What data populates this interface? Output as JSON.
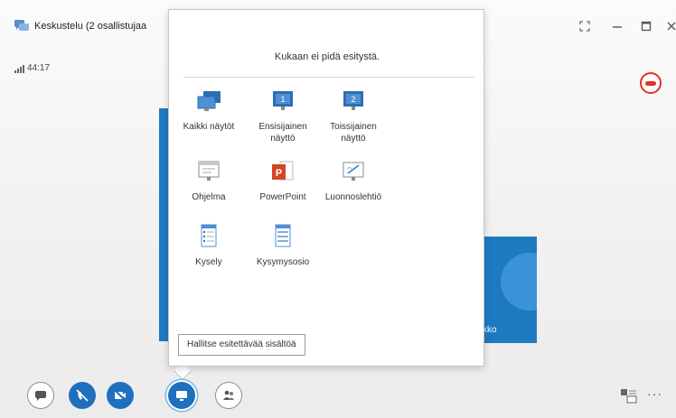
{
  "window": {
    "title": "Keskustelu (2 osallistujaa",
    "controls": [
      "restore",
      "minimize",
      "maximize",
      "close"
    ]
  },
  "call": {
    "timer": "44:17",
    "participant_label": "kko"
  },
  "present_panel": {
    "message": "Kukaan ei pidä esitystä.",
    "items": [
      {
        "label": "Kaikki näytöt",
        "icon": "all-monitors-icon"
      },
      {
        "label": "Ensisijainen näyttö",
        "icon": "primary-monitor-icon"
      },
      {
        "label": "Toissijainen näyttö",
        "icon": "secondary-monitor-icon"
      },
      {
        "label": "Ohjelma",
        "icon": "program-icon"
      },
      {
        "label": "PowerPoint",
        "icon": "powerpoint-icon"
      },
      {
        "label": "Luonnoslehtiö",
        "icon": "whiteboard-icon"
      },
      {
        "label": "Kysely",
        "icon": "poll-icon"
      },
      {
        "label": "Kysymysosio",
        "icon": "qa-icon"
      }
    ],
    "monitor_numbers": [
      "1",
      "2"
    ]
  },
  "tooltip": "Hallitse esitettävää sisältöä",
  "toolbar": {
    "buttons": [
      "im-icon",
      "audio-icon",
      "video-icon",
      "present-icon",
      "participants-icon"
    ],
    "more": "···"
  },
  "colors": {
    "accent": "#1f6fbf",
    "stage_blue": "#1e7ac0",
    "hangup_red": "#e0302a"
  }
}
